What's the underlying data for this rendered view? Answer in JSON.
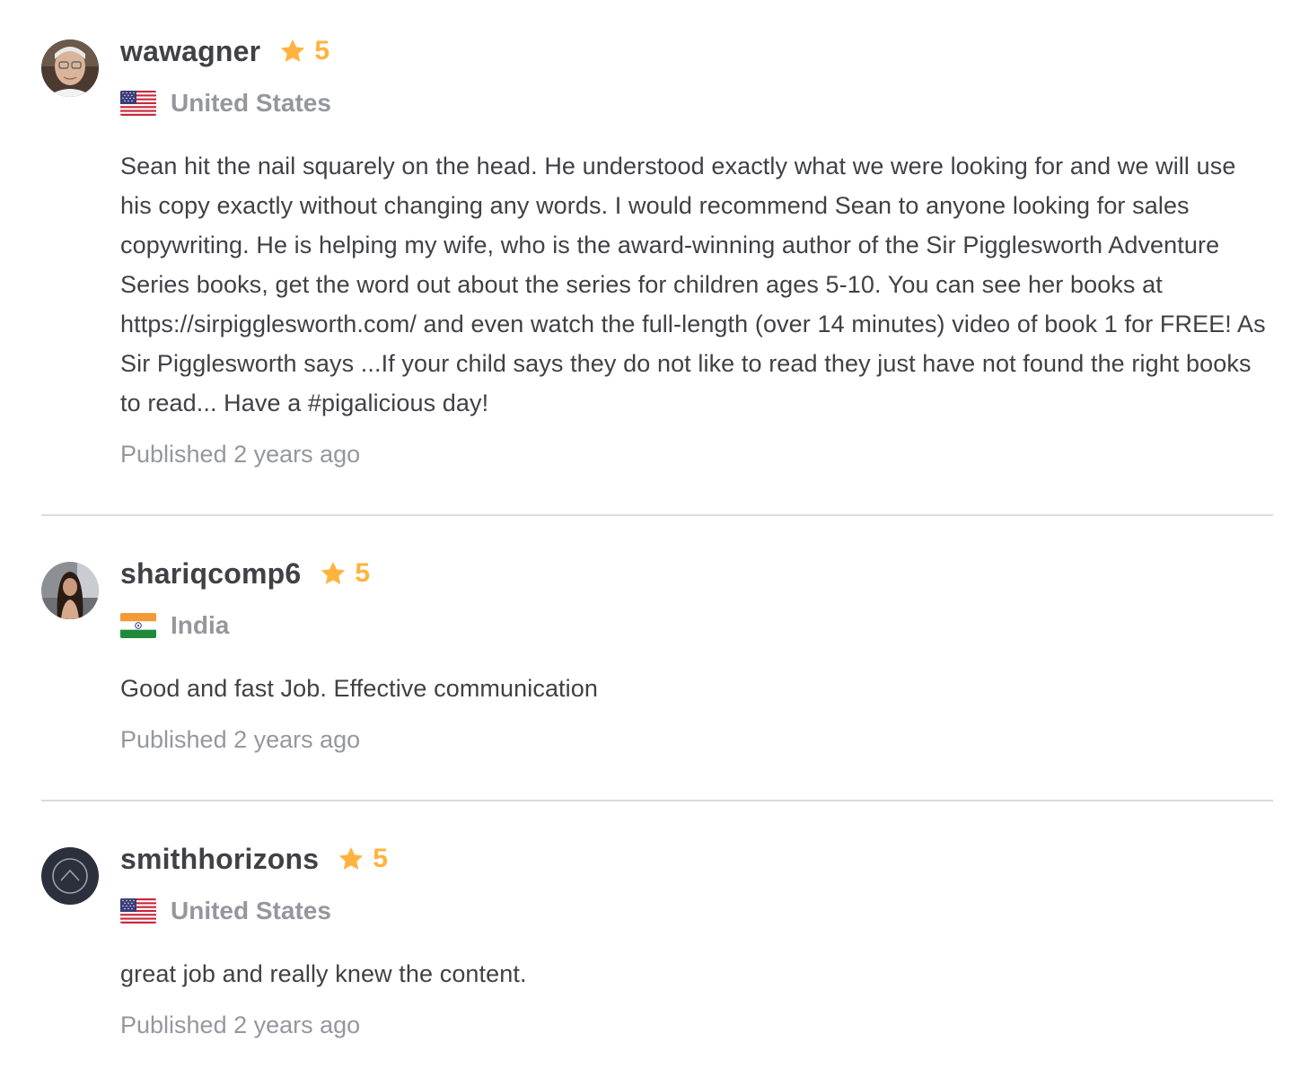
{
  "reviews": [
    {
      "username": "wawagner",
      "rating": "5",
      "country": "United States",
      "flag_icon": "us-flag-icon",
      "text": "Sean hit the nail squarely on the head. He understood exactly what we were looking for and we will use his copy exactly without changing any words. I would recommend Sean to anyone looking for sales copywriting. He is helping my wife, who is the award-winning author of the Sir Pigglesworth Adventure Series books, get the word out about the series for children ages 5-10. You can see her books at https://sirpigglesworth.com/ and even watch the full-length (over 14 minutes) video of book 1 for FREE! As Sir Pigglesworth says ...If your child says they do not like to read they just have not found the right books to read... Have a #pigalicious day!",
      "published": "Published 2 years ago"
    },
    {
      "username": "shariqcomp6",
      "rating": "5",
      "country": "India",
      "flag_icon": "india-flag-icon",
      "text": "Good and fast Job. Effective communication",
      "published": "Published 2 years ago"
    },
    {
      "username": "smithhorizons",
      "rating": "5",
      "country": "United States",
      "flag_icon": "us-flag-icon",
      "text": "great job and really knew the content.",
      "published": "Published 2 years ago"
    }
  ],
  "colors": {
    "star": "#ffb33e",
    "text": "#404145",
    "muted": "#95979d",
    "divider": "#dadbdd"
  }
}
